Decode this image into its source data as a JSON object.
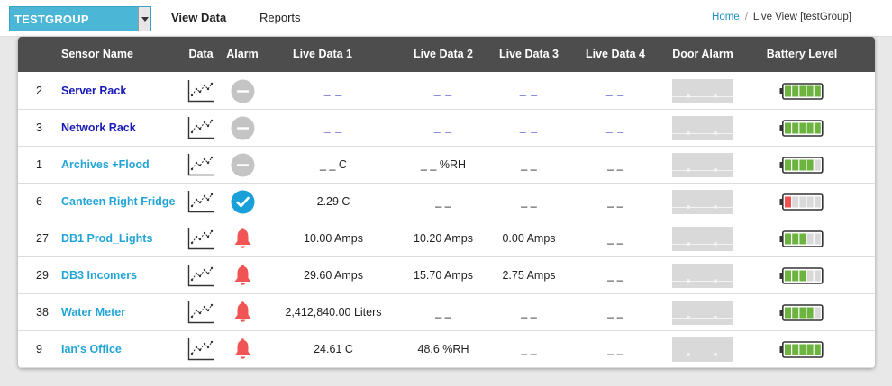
{
  "header": {
    "group_select": "TESTGROUP",
    "nav": {
      "view_data": "View Data",
      "reports": "Reports"
    },
    "breadcrumb": {
      "home": "Home",
      "current": "Live View [testGroup]"
    }
  },
  "table": {
    "columns": {
      "sensor_name": "Sensor Name",
      "data": "Data",
      "alarm": "Alarm",
      "live1": "Live Data 1",
      "live2": "Live Data 2",
      "live3": "Live Data 3",
      "live4": "Live Data 4",
      "door_alarm": "Door Alarm",
      "battery": "Battery Level"
    },
    "rows": [
      {
        "id": "2",
        "name": "Server Rack",
        "name_color": "#1a1ab8",
        "alarm": "disabled",
        "live1": "_ _",
        "live2": "_ _",
        "live3": "_ _",
        "live4": "_ _",
        "live_style": "blue",
        "battery": {
          "level": 5,
          "of": 5,
          "color": "#6db33f"
        }
      },
      {
        "id": "3",
        "name": "Network Rack",
        "name_color": "#1a1ab8",
        "alarm": "disabled",
        "live1": "_ _",
        "live2": "_ _",
        "live3": "_ _",
        "live4": "_ _",
        "live_style": "blue",
        "battery": {
          "level": 5,
          "of": 5,
          "color": "#6db33f"
        }
      },
      {
        "id": "1",
        "name": "Archives +Flood",
        "name_color": "#22a5d6",
        "alarm": "disabled",
        "live1": "_ _ C",
        "live2": "_ _ %RH",
        "live3": "_ _",
        "live4": "_ _",
        "live_style": "plain",
        "battery": {
          "level": 4,
          "of": 5,
          "color": "#6db33f"
        }
      },
      {
        "id": "6",
        "name": "Canteen Right Fridge",
        "name_color": "#22a5d6",
        "alarm": "ok",
        "live1": "2.29 C",
        "live2": "_ _",
        "live3": "_ _",
        "live4": "_ _",
        "live_style": "plain",
        "battery": {
          "level": 1,
          "of": 5,
          "color": "#f05050"
        }
      },
      {
        "id": "27",
        "name": "DB1 Prod_Lights",
        "name_color": "#22a5d6",
        "alarm": "alarm",
        "live1": "10.00 Amps",
        "live2": "10.20 Amps",
        "live3": "0.00 Amps",
        "live4": "_ _",
        "live_style": "plain",
        "battery": {
          "level": 3,
          "of": 5,
          "color": "#6db33f"
        }
      },
      {
        "id": "29",
        "name": "DB3 Incomers",
        "name_color": "#22a5d6",
        "alarm": "alarm",
        "live1": "29.60 Amps",
        "live2": "15.70 Amps",
        "live3": "2.75 Amps",
        "live4": "_ _",
        "live_style": "plain",
        "battery": {
          "level": 3,
          "of": 5,
          "color": "#6db33f"
        }
      },
      {
        "id": "38",
        "name": "Water Meter",
        "name_color": "#22a5d6",
        "alarm": "alarm",
        "live1": "2,412,840.00 Liters",
        "live2": "_ _",
        "live3": "_ _",
        "live4": "_ _",
        "live_style": "plain",
        "battery": {
          "level": 4,
          "of": 5,
          "color": "#6db33f"
        }
      },
      {
        "id": "9",
        "name": "Ian's Office",
        "name_color": "#22a5d6",
        "alarm": "alarm",
        "live1": "24.61 C",
        "live2": "48.6 %RH",
        "live3": "_ _",
        "live4": "_ _",
        "live_style": "plain",
        "battery": {
          "level": 5,
          "of": 5,
          "color": "#6db33f"
        }
      }
    ]
  },
  "colors": {
    "accent": "#4bb6d6",
    "header_bg": "#4d4d4d",
    "alarm_red": "#f05454",
    "ok_blue": "#1aa0d8",
    "disabled_gray": "#c4c4c4"
  },
  "icons": {
    "data": "line-chart-icon",
    "alarm_disabled": "minus-circle-icon",
    "alarm_ok": "check-circle-icon",
    "alarm_active": "bell-icon"
  }
}
